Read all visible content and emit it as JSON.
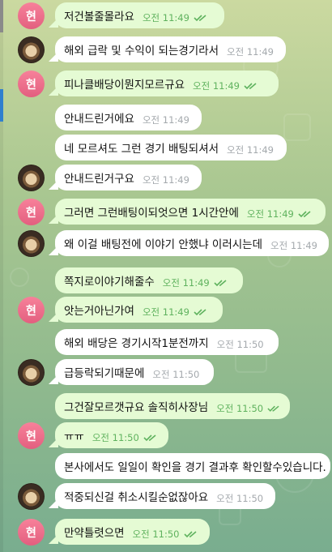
{
  "avatars": {
    "initial": "현"
  },
  "colors": {
    "outgoing_bubble": "#e5fbd4",
    "incoming_bubble": "#ffffff",
    "outgoing_time": "#5fb25e",
    "read_ticks": "#5fb25e",
    "avatar_initial_bg": "#e35f7f"
  },
  "messages": [
    {
      "text": "저건볼줄몰라요",
      "time": "오전 11:49",
      "read": true
    },
    {
      "text": "해외 급락 및 수익이 되는경기라서",
      "time": "오전 11:49"
    },
    {
      "text": "피나클배당이뭔지모르규요",
      "time": "오전 11:49",
      "read": true
    },
    {
      "text": "안내드린거에요",
      "time": "오전 11:49"
    },
    {
      "text": "네 모르셔도 그런 경기 배팅되셔서",
      "time": "오전 11:49"
    },
    {
      "text": "안내드린거구요",
      "time": "오전 11:49"
    },
    {
      "text": "그러면 그런배팅이되엇으면 1시간안에",
      "time": "오전 11:49",
      "read": true
    },
    {
      "text": "왜 이걸 배팅전에 이야기 안했냐 이러시는데",
      "time": "오전 11:49"
    },
    {
      "text": "쪽지로이야기해줄수",
      "time": "오전 11:49",
      "read": true
    },
    {
      "text": "앗는거아닌가여",
      "time": "오전 11:49",
      "read": true
    },
    {
      "text": "해외 배당은 경기시작1분전까지",
      "time": "오전 11:50"
    },
    {
      "text": "급등락되기때문에",
      "time": "오전 11:50"
    },
    {
      "text": "그건잘모르갯규요 솔직히사장님",
      "time": "오전 11:50",
      "read": true
    },
    {
      "text": "ㅠㅠ",
      "time": "오전 11:50",
      "read": true
    },
    {
      "text": "본사에서도 일일이 확인을 경기 결과후 확인할수있습니다.",
      "time": ""
    },
    {
      "text": "적중되신걸 취소시킬순없잖아요",
      "time": "오전 11:50"
    },
    {
      "text": "만약틀렷으면",
      "time": "오전 11:50",
      "read": true
    }
  ]
}
